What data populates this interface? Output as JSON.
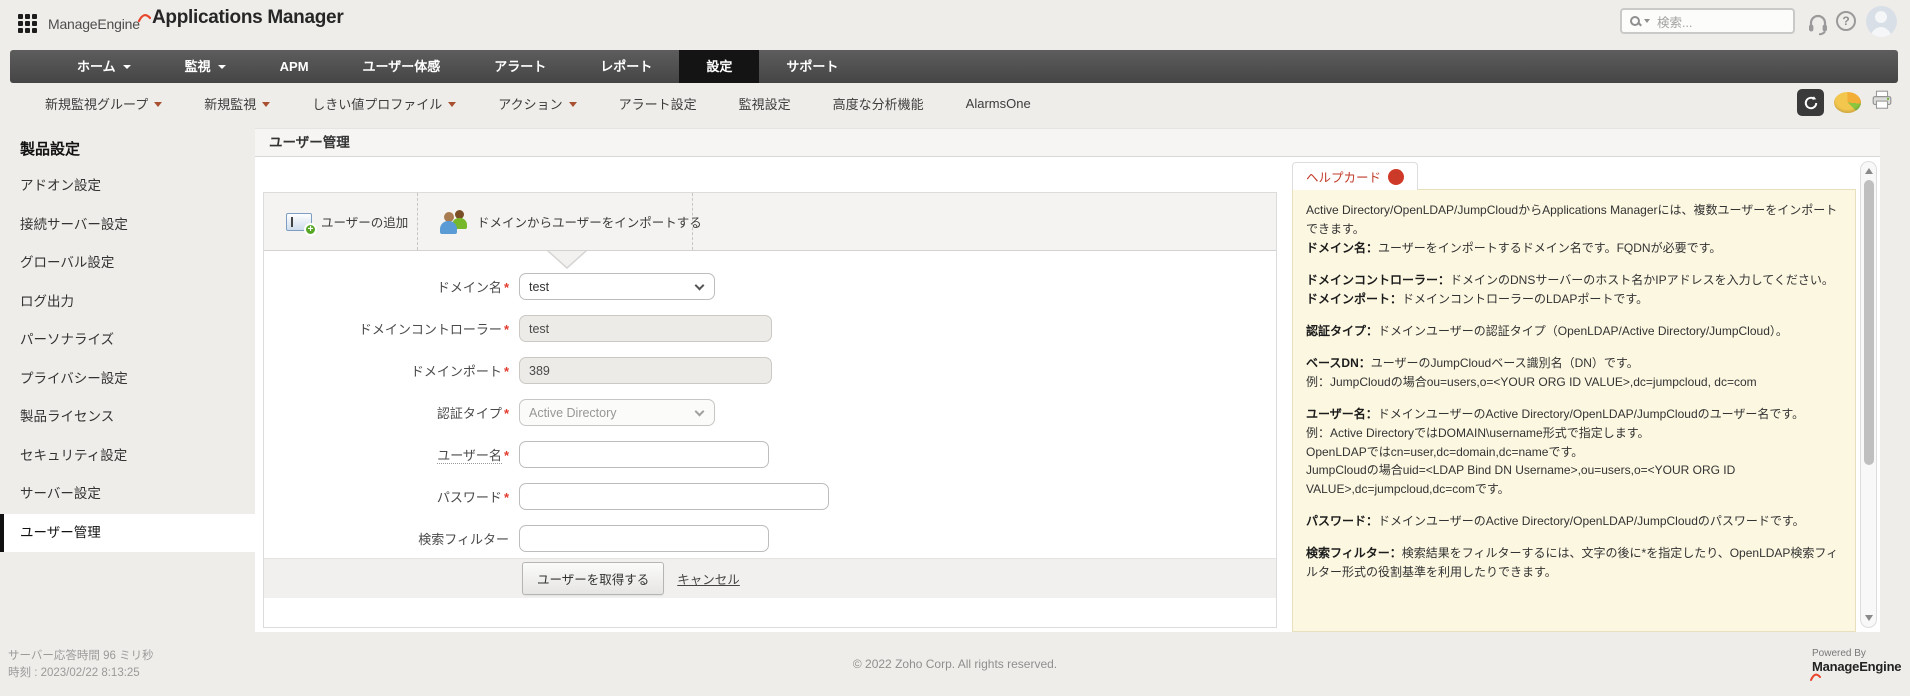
{
  "brand": {
    "company": "ManageEngine",
    "product": "Applications Manager",
    "powered_by": "Powered By",
    "footer_brand": "ManageEngine"
  },
  "topbar": {
    "search_placeholder": "検索..."
  },
  "nav": {
    "items": [
      {
        "label": "ホーム",
        "dropdown": true,
        "active": false
      },
      {
        "label": "監視",
        "dropdown": true,
        "active": false
      },
      {
        "label": "APM",
        "dropdown": false,
        "active": false
      },
      {
        "label": "ユーザー体感",
        "dropdown": false,
        "active": false
      },
      {
        "label": "アラート",
        "dropdown": false,
        "active": false
      },
      {
        "label": "レポート",
        "dropdown": false,
        "active": false
      },
      {
        "label": "設定",
        "dropdown": false,
        "active": true
      },
      {
        "label": "サポート",
        "dropdown": false,
        "active": false
      }
    ]
  },
  "subnav": {
    "items": [
      {
        "label": "新規監視グループ",
        "dropdown": true
      },
      {
        "label": "新規監視",
        "dropdown": true
      },
      {
        "label": "しきい値プロファイル",
        "dropdown": true
      },
      {
        "label": "アクション",
        "dropdown": true
      },
      {
        "label": "アラート設定",
        "dropdown": false
      },
      {
        "label": "監視設定",
        "dropdown": false
      },
      {
        "label": "高度な分析機能",
        "dropdown": false
      },
      {
        "label": "AlarmsOne",
        "dropdown": false
      }
    ],
    "icons": [
      "refresh-icon",
      "pie-chart-icon",
      "printer-icon"
    ]
  },
  "sidebar": {
    "title": "製品設定",
    "items": [
      {
        "label": "アドオン設定",
        "selected": false
      },
      {
        "label": "接続サーバー設定",
        "selected": false
      },
      {
        "label": "グローバル設定",
        "selected": false
      },
      {
        "label": "ログ出力",
        "selected": false
      },
      {
        "label": "パーソナライズ",
        "selected": false
      },
      {
        "label": "プライバシー設定",
        "selected": false
      },
      {
        "label": "製品ライセンス",
        "selected": false
      },
      {
        "label": "セキュリティ設定",
        "selected": false
      },
      {
        "label": "サーバー設定",
        "selected": false
      },
      {
        "label": "ユーザー管理",
        "selected": true
      }
    ]
  },
  "content": {
    "page_title": "ユーザー管理",
    "tabs": [
      {
        "label": "ユーザーの追加",
        "active": false
      },
      {
        "label": "ドメインからユーザーをインポートする",
        "active": true
      }
    ],
    "form": {
      "fields": [
        {
          "label": "ドメイン名",
          "required": true,
          "type": "select",
          "value": "test",
          "disabled": false
        },
        {
          "label": "ドメインコントローラー",
          "required": true,
          "type": "text",
          "value": "test",
          "disabled": true
        },
        {
          "label": "ドメインポート",
          "required": true,
          "type": "text",
          "value": "389",
          "disabled": true
        },
        {
          "label": "認証タイプ",
          "required": true,
          "type": "select",
          "value": "Active Directory",
          "disabled": true
        },
        {
          "label": "ユーザー名",
          "required": true,
          "type": "text",
          "value": "",
          "disabled": false
        },
        {
          "label": "パスワード",
          "required": true,
          "type": "password",
          "value": "",
          "disabled": false
        },
        {
          "label": "検索フィルター",
          "required": false,
          "type": "text",
          "value": "",
          "disabled": false
        }
      ],
      "submit_label": "ユーザーを取得する",
      "cancel_label": "キャンセル"
    }
  },
  "helpcard": {
    "title": "ヘルプカード",
    "paragraphs": [
      [
        {
          "head": "",
          "text": "Active Directory/OpenLDAP/JumpCloudからApplications Managerには、複数ユーザーをインポートできます。"
        },
        {
          "head": "ドメイン名：",
          "text": "ユーザーをインポートするドメイン名です。FQDNが必要です。"
        }
      ],
      [
        {
          "head": "ドメインコントローラー：",
          "text": "ドメインのDNSサーバーのホスト名かIPアドレスを入力してください。"
        },
        {
          "head": "ドメインポート：",
          "text": "ドメインコントローラーのLDAPポートです。"
        }
      ],
      [
        {
          "head": "認証タイプ：",
          "text": "ドメインユーザーの認証タイプ（OpenLDAP/Active Directory/JumpCloud）。"
        }
      ],
      [
        {
          "head": "ベースDN：",
          "text": "ユーザーのJumpCloudベース識別名（DN）です。"
        },
        {
          "head": "",
          "text": "例：JumpCloudの場合ou=users,o=<YOUR ORG ID VALUE>,dc=jumpcloud, dc=com"
        }
      ],
      [
        {
          "head": "ユーザー名：",
          "text": "ドメインユーザーのActive Directory/OpenLDAP/JumpCloudのユーザー名です。"
        },
        {
          "head": "",
          "text": "例：Active DirectoryではDOMAIN\\username形式で指定します。"
        },
        {
          "head": "",
          "text": "OpenLDAPではcn=user,dc=domain,dc=nameです。"
        },
        {
          "head": "",
          "text": "JumpCloudの場合uid=<LDAP Bind DN Username>,ou=users,o=<YOUR ORG ID VALUE>,dc=jumpcloud,dc=comです。"
        }
      ],
      [
        {
          "head": "パスワード：",
          "text": "ドメインユーザーのActive Directory/OpenLDAP/JumpCloudのパスワードです。"
        }
      ],
      [
        {
          "head": "検索フィルター：",
          "text": "検索結果をフィルターするには、文字の後に*を指定したり、OpenLDAP検索フィルター形式の役割基準を利用したりできます。"
        }
      ]
    ]
  },
  "footer": {
    "response_time": "サーバー応答時間 96 ミリ秒",
    "timestamp": "時刻 : 2023/02/22 8:13:25",
    "copyright": "© 2022 Zoho Corp.  All rights reserved."
  },
  "colors": {
    "accent_red": "#c0392b",
    "nav_bg": "#4f4f4f",
    "nav_active": "#141414",
    "help_card_bg": "#fcf7e1",
    "help_card_border": "#e8e0bd",
    "selected_sidebar_border": "#111111"
  }
}
